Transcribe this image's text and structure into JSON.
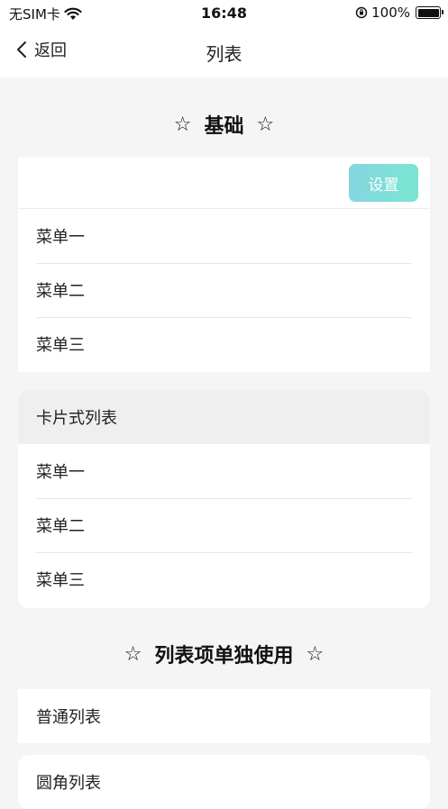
{
  "status": {
    "carrier": "无SIM卡",
    "time": "16:48",
    "battery": "100%"
  },
  "nav": {
    "back_label": "返回",
    "title": "列表"
  },
  "section1": {
    "title": "基础",
    "settings_button": "设置",
    "items": [
      "菜单一",
      "菜单二",
      "菜单三"
    ]
  },
  "card": {
    "header": "卡片式列表",
    "items": [
      "菜单一",
      "菜单二",
      "菜单三"
    ]
  },
  "section2": {
    "title": "列表项单独使用",
    "plain_item": "普通列表",
    "round_item": "圆角列表"
  },
  "colors": {
    "accent_gradient_start": "#6fd0dc",
    "accent_gradient_end": "#64e0c9",
    "page_bg": "#f5f5f5"
  }
}
